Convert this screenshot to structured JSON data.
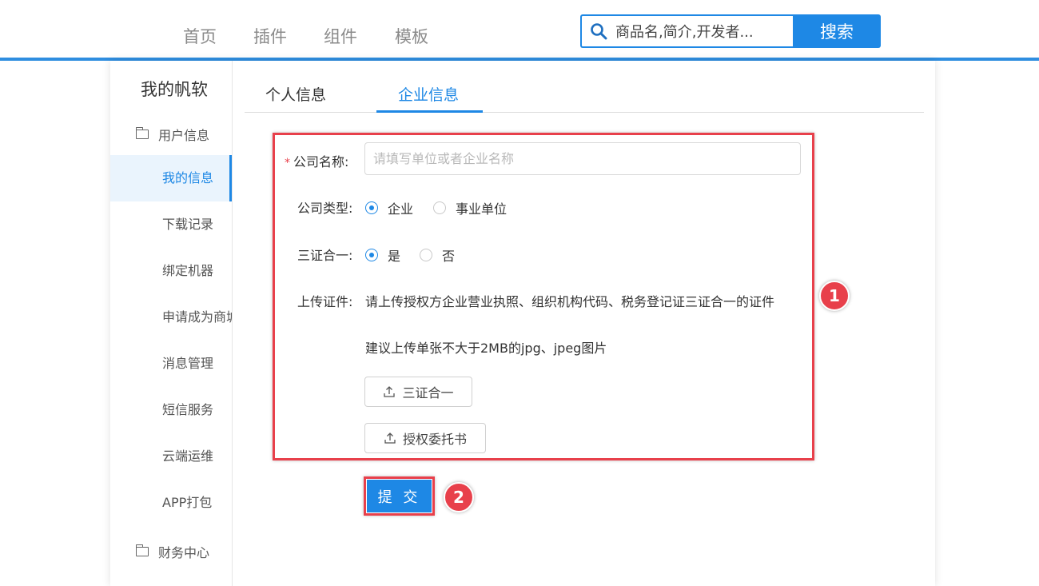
{
  "nav": {
    "items": [
      "首页",
      "插件",
      "组件",
      "模板"
    ],
    "search_placeholder": "商品名,简介,开发者...",
    "search_button": "搜索"
  },
  "sidebar": {
    "title": "我的帆软",
    "group_user": "用户信息",
    "items": [
      "我的信息",
      "下载记录",
      "绑定机器",
      "申请成为商城",
      "消息管理",
      "短信服务",
      "云端运维",
      "APP打包"
    ],
    "group_finance": "财务中心"
  },
  "tabs": {
    "personal": "个人信息",
    "enterprise": "企业信息"
  },
  "form": {
    "required_mark": "*",
    "company_name_label": "公司名称:",
    "company_name_placeholder": "请填写单位或者企业名称",
    "company_type_label": "公司类型:",
    "company_type_options": [
      "企业",
      "事业单位"
    ],
    "three_in_one_label": "三证合一:",
    "three_in_one_options": [
      "是",
      "否"
    ],
    "upload_label": "上传证件:",
    "upload_hint_1": "请上传授权方企业营业执照、组织机构代码、税务登记证三证合一的证件",
    "upload_hint_2": "建议上传单张不大于2MB的jpg、jpeg图片",
    "upload_btn_1": "三证合一",
    "upload_btn_2": "授权委托书",
    "submit": "提 交"
  },
  "annotations": {
    "badge_1": "1",
    "badge_2": "2"
  },
  "colors": {
    "accent": "#1e88e5",
    "highlight": "#e8404b"
  }
}
